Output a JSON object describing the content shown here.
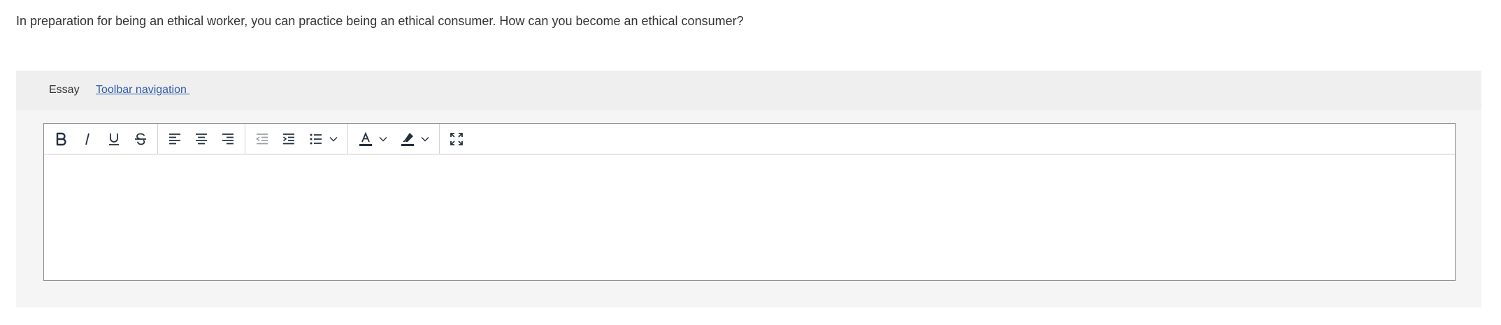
{
  "question": {
    "text": "In preparation for being an ethical worker, you can practice being an ethical consumer. How can you become an ethical consumer?"
  },
  "essay": {
    "title": "Essay",
    "toolbar_nav_link": "Toolbar navigation "
  },
  "toolbar": {
    "groups": [
      [
        "bold-icon",
        "italic-icon",
        "underline-icon",
        "strikethrough-icon"
      ],
      [
        "align-left-icon",
        "align-center-icon",
        "align-right-icon"
      ],
      [
        "outdent-icon",
        "indent-icon",
        "bullet-list-icon"
      ],
      [
        "text-color-icon",
        "highlight-color-icon"
      ],
      [
        "fullscreen-icon"
      ]
    ]
  },
  "editor": {
    "content": ""
  },
  "colors": {
    "text": "#333333",
    "link": "#2f5aa8",
    "panel_bg": "#f5f5f5",
    "header_bg": "#efefef",
    "icon": "#222f3e",
    "icon_disabled": "#9aa0a6"
  }
}
